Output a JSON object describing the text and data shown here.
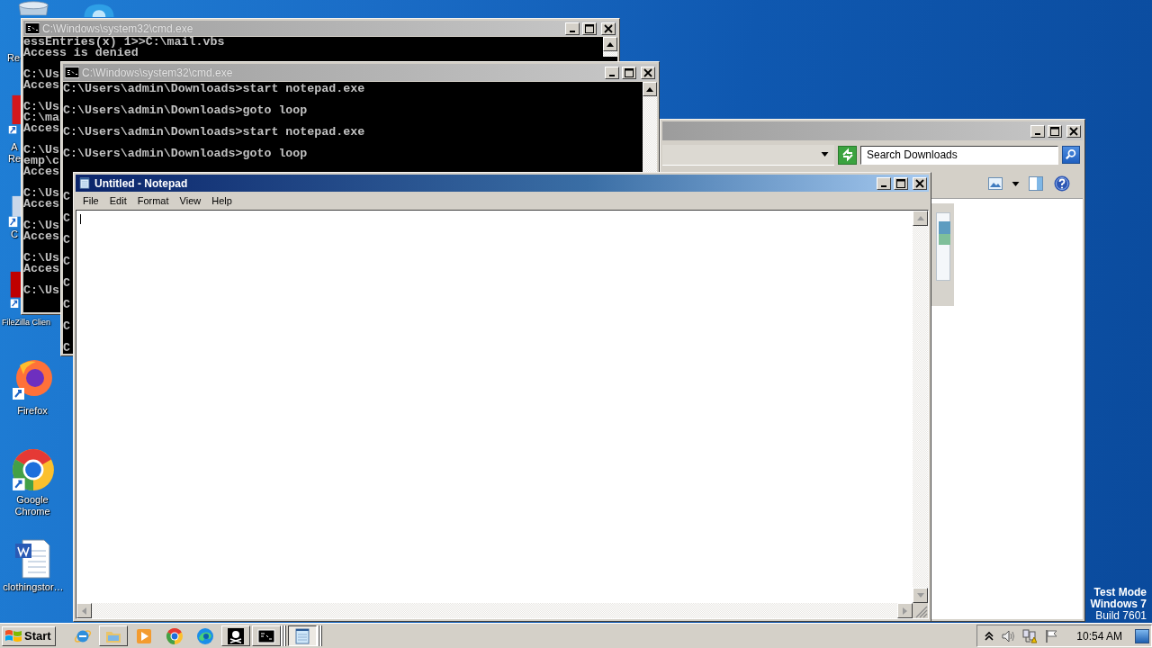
{
  "desktop": {
    "icons": [
      {
        "kind": "bin",
        "label_lines": [
          "Re"
        ]
      },
      {
        "kind": "app"
      },
      {
        "kind": "pdf",
        "label_lines": [
          "A",
          "Re"
        ]
      },
      {
        "kind": "shortcut",
        "label_lines": [
          "C"
        ]
      },
      {
        "kind": "ftp",
        "label_lines": [
          "FileZilla Clien"
        ]
      },
      {
        "kind": "firefox",
        "label_lines": [
          "Firefox"
        ]
      },
      {
        "kind": "chrome",
        "label_lines": [
          "Google",
          "Chrome"
        ]
      },
      {
        "kind": "word",
        "label_lines": [
          "clothingstor…"
        ]
      }
    ],
    "notice": {
      "lines": [
        "Test Mode",
        "Windows 7"
      ],
      "build": "Build 7601"
    }
  },
  "windows": [
    {
      "kind": "console",
      "active": false,
      "title": "C:\\Windows\\system32\\cmd.exe",
      "blocks": [
        {
          "lines": [
            "essEntries(x) 1>>C:\\mail.vbs",
            "Access is denied"
          ]
        },
        {
          "lines": [
            "C:\\Us",
            "Acces"
          ]
        },
        {
          "lines": [
            "C:\\Us",
            "C:\\ma",
            "Acces"
          ]
        },
        {
          "lines": [
            "C:\\Us",
            "emp\\c",
            "Acces"
          ]
        },
        {
          "lines": [
            "C:\\Us",
            "Acces"
          ]
        },
        {
          "lines": [
            "C:\\Us",
            "Acces"
          ]
        },
        {
          "lines": [
            "C:\\Us",
            "Acces"
          ]
        },
        {
          "lines": [
            "C:\\Us"
          ]
        }
      ]
    },
    {
      "kind": "console",
      "active": false,
      "title": "C:\\Windows\\system32\\cmd.exe",
      "blocks": [
        {
          "lines": [
            "C:\\Users\\admin\\Downloads>start notepad.exe"
          ]
        },
        {
          "lines": [
            "C:\\Users\\admin\\Downloads>goto loop"
          ]
        },
        {
          "lines": [
            "C:\\Users\\admin\\Downloads>start notepad.exe"
          ]
        },
        {
          "lines": [
            "C:\\Users\\admin\\Downloads>goto loop"
          ]
        },
        {
          "lines": [
            "C"
          ]
        },
        {
          "lines": [
            "C"
          ]
        },
        {
          "lines": [
            "C"
          ]
        },
        {
          "lines": [
            "C"
          ]
        },
        {
          "lines": [
            "C"
          ]
        },
        {
          "lines": [
            "C"
          ]
        },
        {
          "lines": [
            "C"
          ]
        },
        {
          "lines": [
            "C"
          ]
        }
      ]
    },
    {
      "kind": "explorer",
      "active": false,
      "search": {
        "placeholder": "Search Downloads"
      }
    },
    {
      "kind": "notepad",
      "active": true,
      "title": "Untitled - Notepad",
      "menu": [
        "File",
        "Edit",
        "Format",
        "View",
        "Help"
      ]
    }
  ],
  "taskbar": {
    "start": "Start",
    "apps": [
      {
        "kind": "ie",
        "running": false,
        "selected": false,
        "grouped": false
      },
      {
        "kind": "folder",
        "running": true,
        "selected": false,
        "grouped": false
      },
      {
        "kind": "media",
        "running": false,
        "selected": false,
        "grouped": false
      },
      {
        "kind": "chrome",
        "running": false,
        "selected": false,
        "grouped": false
      },
      {
        "kind": "edge",
        "running": false,
        "selected": false,
        "grouped": false
      },
      {
        "kind": "pirate",
        "running": true,
        "selected": false,
        "grouped": false
      },
      {
        "kind": "console",
        "running": true,
        "selected": false,
        "grouped": true
      },
      {
        "kind": "notepad",
        "running": true,
        "selected": true,
        "grouped": true
      }
    ],
    "clock": "10:54 AM"
  }
}
